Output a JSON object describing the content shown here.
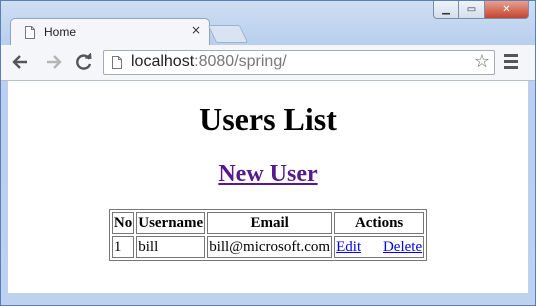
{
  "browser": {
    "tab_title": "Home",
    "tab_close": "×",
    "url_host": "localhost",
    "url_port_path": ":8080/spring/",
    "controls": {
      "minimize": "▁",
      "maximize": "▭",
      "close": "✕"
    },
    "icons": {
      "back": "back-arrow-icon",
      "forward": "forward-arrow-icon",
      "reload": "reload-icon",
      "page": "page-icon",
      "bookmark": "star-icon",
      "menu": "hamburger-menu-icon"
    },
    "colors": {
      "frame": "#b9d0ee",
      "close_button": "#c5442f"
    }
  },
  "page": {
    "title": "Users List",
    "new_user_link": "New User",
    "table": {
      "headers": [
        "No",
        "Username",
        "Email",
        "Actions"
      ],
      "rows": [
        {
          "no": "1",
          "username": "bill",
          "email": "bill@microsoft.com",
          "edit": "Edit",
          "delete": "Delete"
        }
      ]
    }
  }
}
